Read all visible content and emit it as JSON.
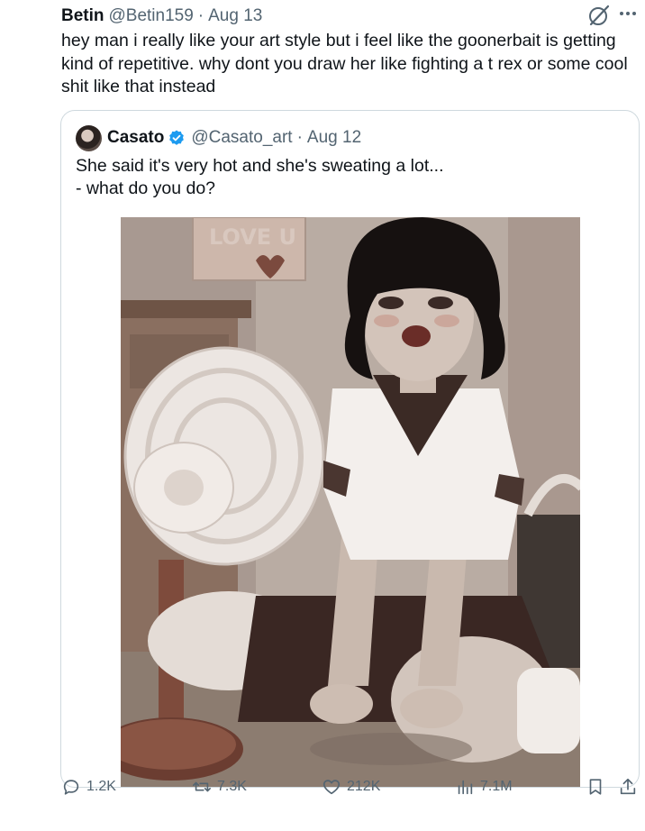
{
  "tweet": {
    "author_name": "Betin",
    "author_handle": "@Betin159",
    "separator": "·",
    "date": "Aug 13",
    "text": "hey man i really like your art style but i feel like the goonerbait is getting kind of repetitive. why dont you draw her like fighting a t rex or some cool shit like that instead",
    "more_icon": "more-icon",
    "grok_icon": "grok-icon"
  },
  "quote": {
    "author_name": "Casato",
    "verified_icon": "verified-badge-icon",
    "author_handle": "@Casato_art",
    "separator": "·",
    "date": "Aug 12",
    "text": "She said it's very hot and she's sweating a lot...\n- what do you do?",
    "image_poster_text": "LOVE U"
  },
  "actions": {
    "replies": "1.2K",
    "reposts": "7.3K",
    "likes": "212K",
    "views": "7.1M",
    "icons": [
      "reply-icon",
      "repost-icon",
      "like-icon",
      "views-icon",
      "bookmark-icon",
      "share-icon"
    ]
  },
  "colors": {
    "text_primary": "#0f1419",
    "text_secondary": "#536471",
    "border": "#cfd9de",
    "verified": "#1d9bf0"
  }
}
